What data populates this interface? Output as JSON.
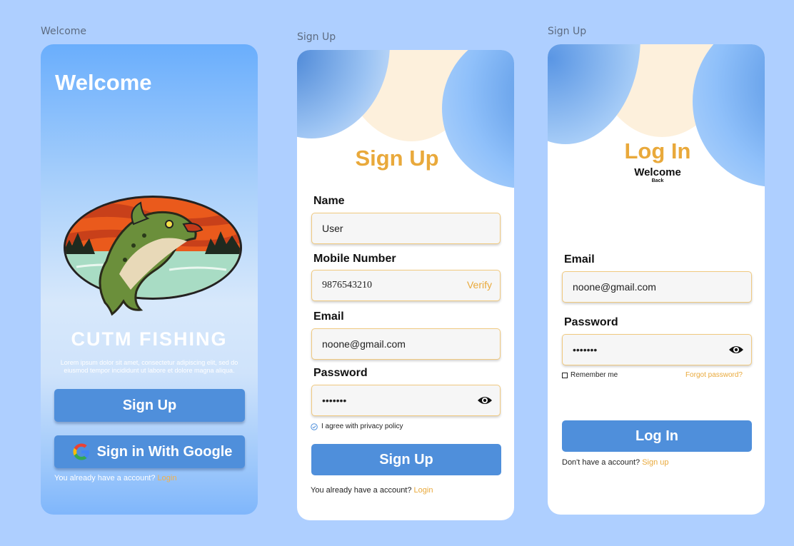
{
  "frames": {
    "welcome_label": "Welcome",
    "signup_label": "Sign Up",
    "login_label": "Sign Up"
  },
  "welcome": {
    "title": "Welcome",
    "brand": "CUTM FISHING",
    "description": "Lorem ipsum dolor sit amet, consectetur adipiscing elit, sed do eiusmod tempor incididunt ut labore et dolore magna aliqua.",
    "signup_button": "Sign Up",
    "google_button": "Sign in With Google",
    "footer_text": "You already have a account?",
    "footer_link": "Login"
  },
  "signup": {
    "title": "Sign Up",
    "name_label": "Name",
    "name_value": "User",
    "mobile_label": "Mobile Number",
    "mobile_value": "9876543210",
    "verify_link": "Verify",
    "email_label": "Email",
    "email_value": "noone@gmail.com",
    "password_label": "Password",
    "password_value": "•••••••",
    "agree_text": "I agree with privacy policy",
    "submit_button": "Sign Up",
    "footer_text": "You already have a account?",
    "footer_link": "Login"
  },
  "login": {
    "title": "Log In",
    "welcome": "Welcome",
    "back": "Back",
    "email_label": "Email",
    "email_value": "noone@gmail.com",
    "password_label": "Password",
    "password_value": "•••••••",
    "remember_me": "Remember me",
    "forgot_password": "Forgot password?",
    "submit_button": "Log In",
    "footer_text": "Don't have a account?",
    "footer_link": "Sign up"
  },
  "colors": {
    "page_bg": "#aecfff",
    "primary_blue": "#4f8fdb",
    "accent_orange": "#e9a93b",
    "field_border": "#f0c97f"
  }
}
